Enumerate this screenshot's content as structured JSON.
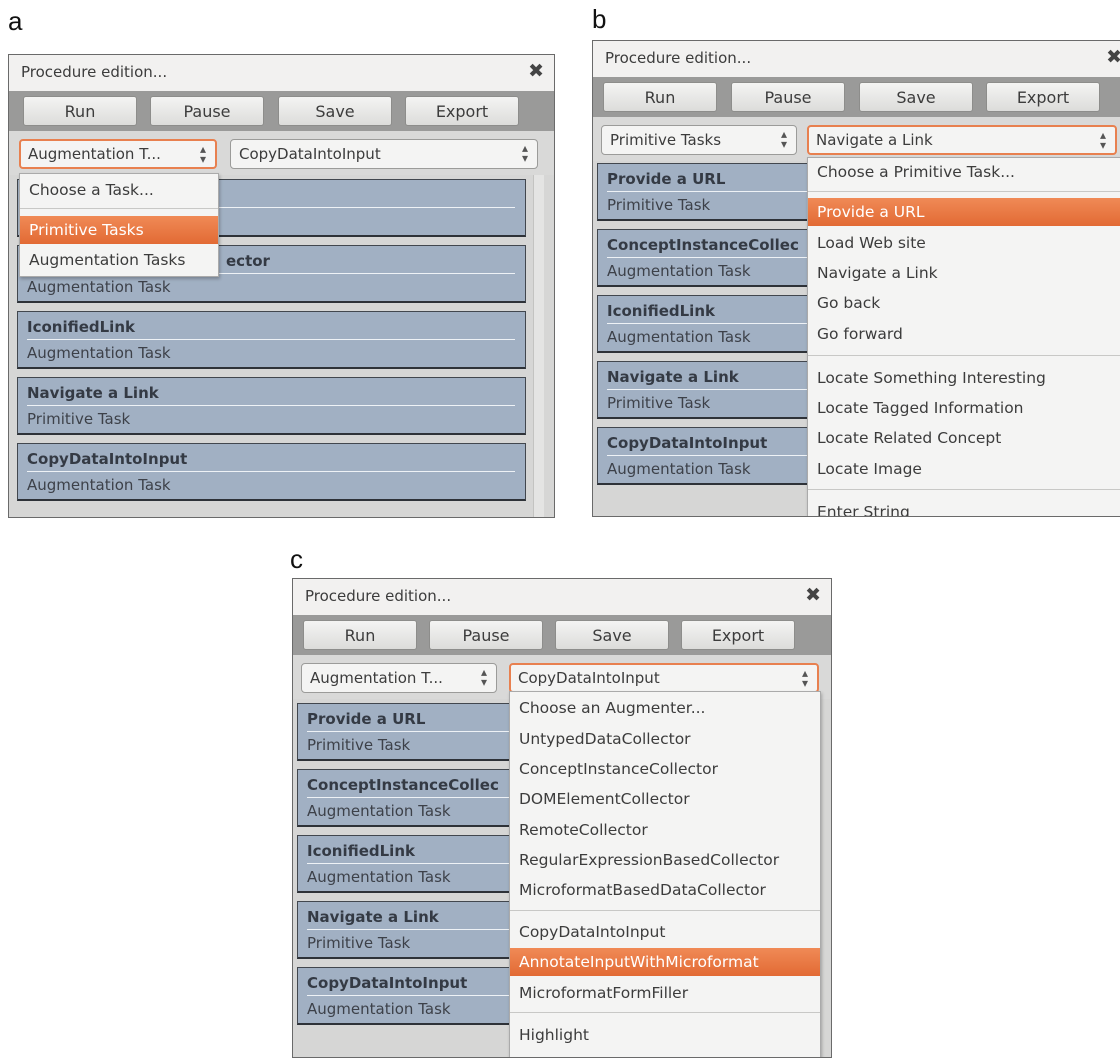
{
  "panels": [
    {
      "letter": "a",
      "window_title": "Procedure edition...",
      "buttons": [
        "Run",
        "Pause",
        "Save",
        "Export"
      ],
      "combo_left": "Augmentation T...",
      "combo_right": "CopyDataIntoInput",
      "tasks": [
        {
          "name": "",
          "type": ""
        },
        {
          "name": "ector",
          "type": "Augmentation Task"
        },
        {
          "name": "IconifiedLink",
          "type": "Augmentation Task"
        },
        {
          "name": "Navigate a Link",
          "type": "Primitive Task"
        },
        {
          "name": "CopyDataIntoInput",
          "type": "Augmentation Task"
        }
      ],
      "menu": [
        "Choose a Task...",
        "Primitive Tasks",
        "Augmentation Tasks"
      ]
    },
    {
      "letter": "b",
      "window_title": "Procedure edition...",
      "buttons": [
        "Run",
        "Pause",
        "Save",
        "Export"
      ],
      "combo_left": "Primitive Tasks",
      "combo_right": "Navigate a Link",
      "tasks": [
        {
          "name": "Provide a URL",
          "type": "Primitive Task"
        },
        {
          "name": "ConceptInstanceCollec",
          "type": "Augmentation Task"
        },
        {
          "name": "IconifiedLink",
          "type": "Augmentation Task"
        },
        {
          "name": "Navigate a Link",
          "type": "Primitive Task"
        },
        {
          "name": "CopyDataIntoInput",
          "type": "Augmentation Task"
        }
      ],
      "menu": [
        "Choose a Primitive Task...",
        "Provide a URL",
        "Load Web site",
        "Navigate a Link",
        "Go back",
        "Go forward",
        "Locate Something Interesting",
        "Locate Tagged Information",
        "Locate Related Concept",
        "Locate Image",
        "Enter String"
      ]
    },
    {
      "letter": "c",
      "window_title": "Procedure edition...",
      "buttons": [
        "Run",
        "Pause",
        "Save",
        "Export"
      ],
      "combo_left": "Augmentation T...",
      "combo_right": "CopyDataIntoInput",
      "tasks": [
        {
          "name": "Provide a URL",
          "type": "Primitive Task"
        },
        {
          "name": "ConceptInstanceCollec",
          "type": "Augmentation Task"
        },
        {
          "name": "IconifiedLink",
          "type": "Augmentation Task"
        },
        {
          "name": "Navigate a Link",
          "type": "Primitive Task"
        },
        {
          "name": "CopyDataIntoInput",
          "type": "Augmentation Task"
        }
      ],
      "menu": [
        "Choose an Augmenter...",
        "UntypedDataCollector",
        "ConceptInstanceCollector",
        "DOMElementCollector",
        "RemoteCollector",
        "RegularExpressionBasedCollector",
        "MicroformatBasedDataCollector",
        "CopyDataIntoInput",
        "AnnotateInputWithMicroformat",
        "MicroformatFormFiller",
        "Highlight"
      ]
    }
  ],
  "icons": {
    "close": "close-x-icon",
    "spin": "up-down-spinner-icon"
  },
  "colors": {
    "selected": "#e8804f",
    "task_card": "#a1b0c3"
  }
}
